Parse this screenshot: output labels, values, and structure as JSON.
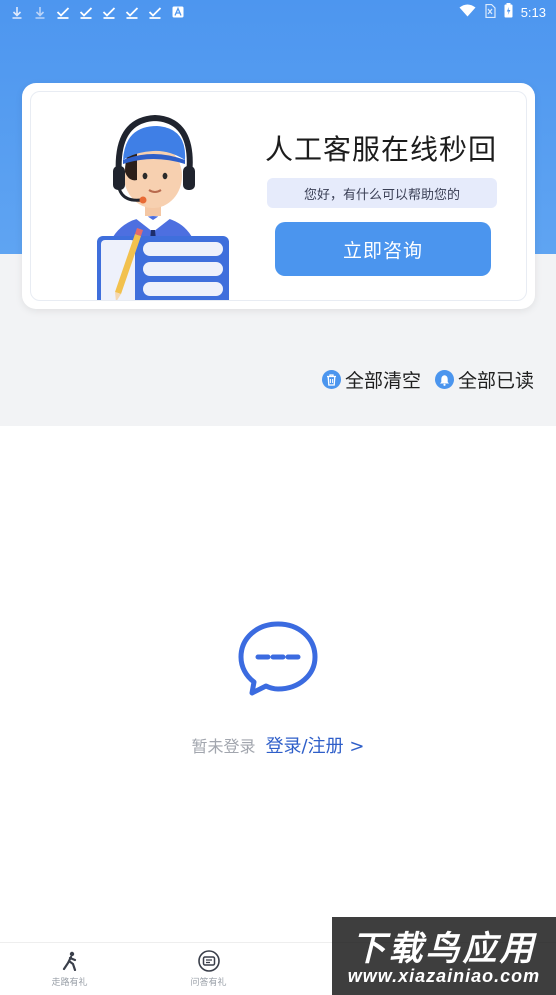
{
  "status_bar": {
    "time": "5:13",
    "left_icons": [
      "download-icon",
      "download-icon",
      "check-icon",
      "check-icon",
      "check-icon",
      "check-icon",
      "check-icon",
      "text-a-icon"
    ],
    "right_icons": [
      "wifi-icon",
      "sim-icon",
      "battery-icon"
    ]
  },
  "service_card": {
    "title": "人工客服在线秒回",
    "subtitle": "您好，有什么可以帮助您的",
    "button_label": "立即咨询"
  },
  "actions": {
    "clear_all": "全部清空",
    "mark_all_read": "全部已读"
  },
  "empty_state": {
    "hint": "暂未登录",
    "login_link": "登录/注册 >"
  },
  "bottom_nav": {
    "items": [
      {
        "label": "走路有礼",
        "icon": "walking-icon"
      },
      {
        "label": "问答有礼",
        "icon": "quiz-icon"
      },
      {
        "label": "",
        "icon": "gift-icon"
      },
      {
        "label": "",
        "icon": "message-icon"
      }
    ]
  },
  "watermark": {
    "title": "下载鸟应用",
    "url": "www.xiazainiao.com"
  },
  "colors": {
    "accent": "#4b95ee",
    "link": "#2f5fc9",
    "header_bg": "#5fa4f2",
    "page_bg": "#f2f3f5"
  }
}
